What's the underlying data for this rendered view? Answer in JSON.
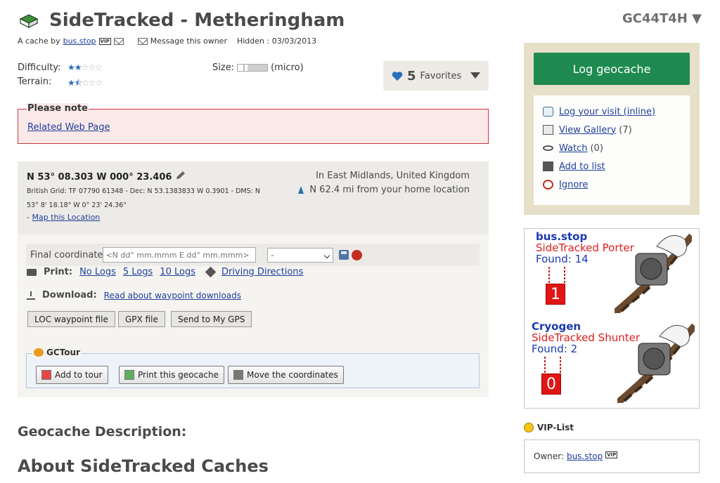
{
  "header": {
    "title": "SideTracked - Metheringham",
    "gc_code": "GC44T4H",
    "byline_prefix": "A cache by",
    "owner": "bus.stop",
    "vip_badge": "VIP",
    "message_owner": "Message this owner",
    "hidden": "Hidden : 03/03/2013"
  },
  "ratings": {
    "difficulty_label": "Difficulty:",
    "difficulty": 2,
    "terrain_label": "Terrain:",
    "terrain": 1.5,
    "size_label": "Size:",
    "size_value": "(micro)"
  },
  "favorites": {
    "count": "5",
    "label": "Favorites"
  },
  "note": {
    "legend": "Please note",
    "link": "Related Web Page"
  },
  "location": {
    "coords": "N 53° 08.303 W 000° 23.406",
    "grid_text": "British Grid: TF 07790 61348 - Dec: N 53.1383833 W 0.3901 - DMS: N 53° 8' 18.18\" W 0° 23' 24.36\"",
    "map_prefix": "- ",
    "map_link": "Map this Location",
    "region": "In East Midlands, United Kingdom",
    "distance": "N 62.4 mi from your home location"
  },
  "final_coordinate": {
    "label": "Final coordinate",
    "placeholder": "<N dd° mm.mmm E dd° mm.mmm>",
    "select_value": "-"
  },
  "print": {
    "label": "Print:",
    "no_logs": "No Logs",
    "five_logs": "5 Logs",
    "ten_logs": "10 Logs",
    "directions": "Driving Directions"
  },
  "download": {
    "label": "Download:",
    "link": "Read about waypoint downloads",
    "buttons": [
      "LOC waypoint file",
      "GPX file",
      "Send to My GPS"
    ]
  },
  "gctour": {
    "legend": "GCTour",
    "add": "Add to tour",
    "print": "Print this geocache",
    "move": "Move the coordinates"
  },
  "description": {
    "heading": "Geocache Description:",
    "about": "About SideTracked Caches"
  },
  "sidebar": {
    "log_button": "Log geocache",
    "links": {
      "log_visit": "Log your visit (inline)",
      "gallery": "View Gallery",
      "gallery_count": "(7)",
      "watch": "Watch",
      "watch_count": "(0)",
      "add_list": "Add to list",
      "ignore": "Ignore"
    }
  },
  "trackables": [
    {
      "name": "bus.stop",
      "title": "SideTracked Porter",
      "found_label": "Found:",
      "found": "14",
      "counter": "1"
    },
    {
      "name": "Cryogen",
      "title": "SideTracked Shunter",
      "found_label": "Found:",
      "found": "2",
      "counter": "0"
    }
  ],
  "vip": {
    "heading": "VIP-List",
    "owner_label": "Owner:",
    "owner": "bus.stop",
    "badge": "VIP"
  },
  "colors": {
    "log_button": "#1f8a4f",
    "link": "#1f3f9a",
    "note_border": "#c9363e",
    "sidebar_bg": "#e6e0c9"
  }
}
